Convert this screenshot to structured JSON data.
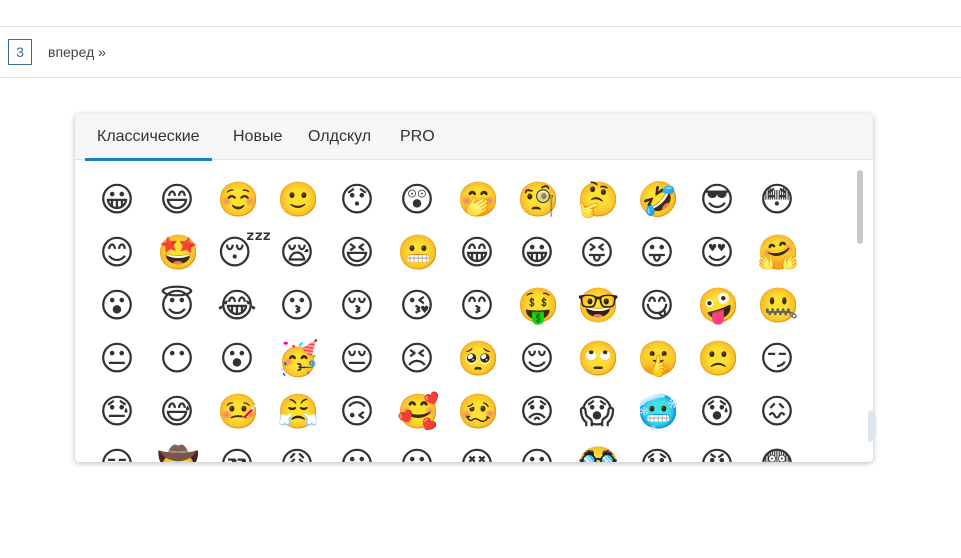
{
  "pagination": {
    "page": "3",
    "next_label": "вперед »"
  },
  "picker": {
    "tabs": [
      {
        "label": "Классические",
        "active": true
      },
      {
        "label": "Новые",
        "active": false
      },
      {
        "label": "Олдскул",
        "active": false
      },
      {
        "label": "PRO",
        "active": false
      }
    ],
    "accent_color": "#1a7fc1",
    "rows": [
      [
        "😀",
        "😄",
        "☺️",
        "🙂",
        "😯",
        "😲",
        "🤭",
        "🧐",
        "🤔",
        "🤣",
        "😎",
        "😳"
      ],
      [
        "😊",
        "🤩",
        "😴",
        "😪",
        "😆",
        "😬",
        "😁",
        "😀",
        "😝",
        "😛",
        "😍",
        "🤗"
      ],
      [
        "😮",
        "😇",
        "😂",
        "😗",
        "😚",
        "😘",
        "😙",
        "🤑",
        "🤓",
        "😋",
        "🤪",
        "🤐"
      ],
      [
        "😐",
        "😶",
        "😮",
        "🥳",
        "😔",
        "😣",
        "🥺",
        "😌",
        "🙄",
        "🤫",
        "🙁",
        "😏"
      ],
      [
        "😓",
        "😅",
        "🤒",
        "😤",
        "🙃",
        "🥰",
        "🥴",
        "😟",
        "😱",
        "🥶",
        "😰",
        "😖"
      ],
      [
        "😑",
        "🤠",
        "😒",
        "😩",
        "😶",
        "😦",
        "😵",
        "😕",
        "🥸",
        "😞",
        "😡",
        "😨"
      ]
    ]
  }
}
